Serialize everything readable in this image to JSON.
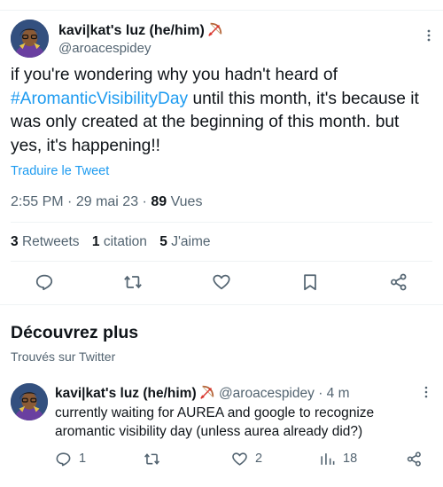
{
  "main_tweet": {
    "author_name": "kavi|kat's luz (he/him)",
    "handle": "@aroacespidey",
    "text_before": "if you're wondering why you hadn't heard of ",
    "hashtag": "#AromanticVisibilityDay",
    "text_after": " until this month, it's because it was only created at the beginning of this month. but yes, it's happening!!",
    "translate_label": "Traduire le Tweet",
    "time": "2:55 PM",
    "date": "29 mai 23",
    "views_count": "89",
    "views_label": "Vues",
    "retweets_count": "3",
    "retweets_label": "Retweets",
    "quotes_count": "1",
    "quotes_label": "citation",
    "likes_count": "5",
    "likes_label": "J'aime"
  },
  "discover": {
    "title": "Découvrez plus",
    "subtitle": "Trouvés sur Twitter"
  },
  "related_tweet": {
    "author_name": "kavi|kat's luz (he/him)",
    "handle": "@aroacespidey",
    "time_ago": "4 m",
    "text": "currently waiting for AUREA and google to recognize aromantic visibility day (unless aurea already did?)",
    "replies": "1",
    "likes": "2",
    "views": "18"
  },
  "icons": {
    "action_color": "#536471",
    "link_color": "#1d9bf0"
  }
}
